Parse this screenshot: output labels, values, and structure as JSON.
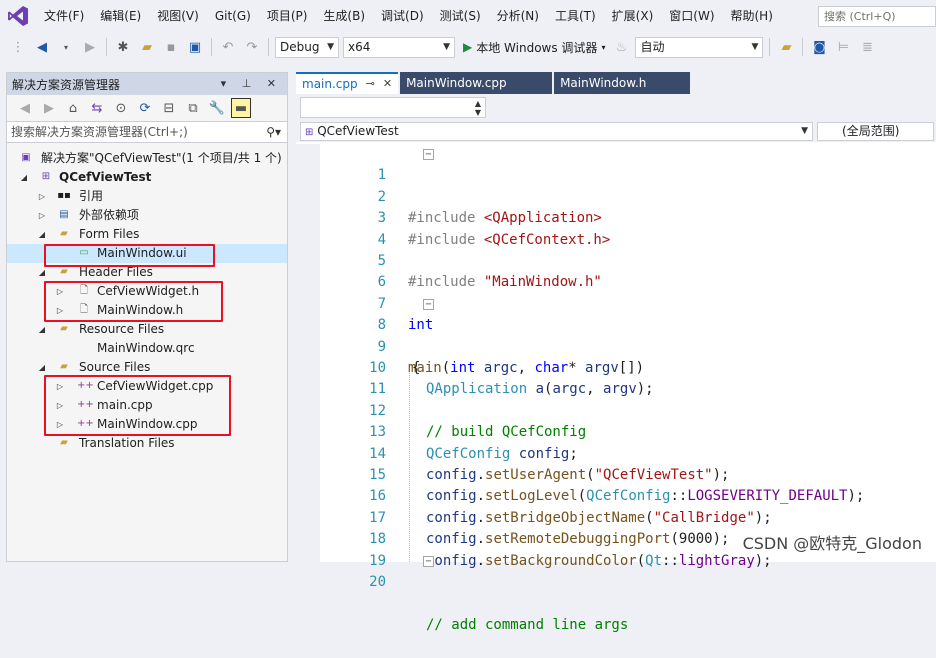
{
  "menu": {
    "items": [
      "文件(F)",
      "编辑(E)",
      "视图(V)",
      "Git(G)",
      "项目(P)",
      "生成(B)",
      "调试(D)",
      "测试(S)",
      "分析(N)",
      "工具(T)",
      "扩展(X)",
      "窗口(W)",
      "帮助(H)"
    ],
    "search_placeholder": "搜索 (Ctrl+Q)"
  },
  "toolbar": {
    "config": "Debug",
    "platform": "x64",
    "run_label": "本地 Windows 调试器",
    "mode": "自动"
  },
  "solution_explorer": {
    "title": "解决方案资源管理器",
    "search_placeholder": "搜索解决方案资源管理器(Ctrl+;)",
    "items": [
      {
        "label": "解决方案\"QCefViewTest\"(1 个项目/共 1 个)"
      },
      {
        "label": "QCefViewTest"
      },
      {
        "label": "引用"
      },
      {
        "label": "外部依赖项"
      },
      {
        "label": "Form Files"
      },
      {
        "label": "MainWindow.ui"
      },
      {
        "label": "Header Files"
      },
      {
        "label": "CefViewWidget.h"
      },
      {
        "label": "MainWindow.h"
      },
      {
        "label": "Resource Files"
      },
      {
        "label": "MainWindow.qrc"
      },
      {
        "label": "Source Files"
      },
      {
        "label": "CefViewWidget.cpp"
      },
      {
        "label": "main.cpp"
      },
      {
        "label": "MainWindow.cpp"
      },
      {
        "label": "Translation Files"
      }
    ]
  },
  "editor": {
    "tabs": [
      {
        "label": "main.cpp"
      },
      {
        "label": "MainWindow.cpp"
      },
      {
        "label": "MainWindow.h"
      }
    ],
    "project_dropdown": "QCefViewTest",
    "scope_dropdown": "(全局范围)",
    "line_numbers": [
      "1",
      "2",
      "3",
      "4",
      "5",
      "6",
      "7",
      "8",
      "9",
      "10",
      "11",
      "12",
      "13",
      "14",
      "15",
      "16",
      "17",
      "18",
      "19",
      "20"
    ],
    "code": {
      "l1_inc": "#include ",
      "l1_hdr": "<QApplication>",
      "l3_inc": "#include ",
      "l3_hdr": "<QCefContext.h>",
      "l5_inc": "#include ",
      "l5_hdr": "\"MainWindow.h\"",
      "l7": "int",
      "l8_main": "main",
      "l8_a": "(",
      "l8_int": "int",
      "l8_argc": " argc",
      "l8_c": ", ",
      "l8_char": "char",
      "l8_star": "* ",
      "l8_argv": "argv",
      "l8_end": "[])",
      "l9": "{",
      "l10_cls": "QApplication",
      "l10_a": " a",
      "l10_p": "(",
      "l10_argc": "argc",
      "l10_c": ", ",
      "l10_argv": "argv",
      "l10_end": ");",
      "l12": "// build QCefConfig",
      "l13_cls": "QCefConfig",
      "l13_var": " config",
      "l13_end": ";",
      "l14_obj": "config",
      "l14_dot": ".",
      "l14_fn": "setUserAgent",
      "l14_p": "(",
      "l14_str": "\"QCefViewTest\"",
      "l14_end": ");",
      "l15_obj": "config",
      "l15_dot": ".",
      "l15_fn": "setLogLevel",
      "l15_p": "(",
      "l15_cls": "QCefConfig",
      "l15_sc": "::",
      "l15_mac": "LOGSEVERITY_DEFAULT",
      "l15_end": ");",
      "l16_obj": "config",
      "l16_dot": ".",
      "l16_fn": "setBridgeObjectName",
      "l16_p": "(",
      "l16_str": "\"CallBridge\"",
      "l16_end": ");",
      "l17_obj": "config",
      "l17_dot": ".",
      "l17_fn": "setRemoteDebuggingPort",
      "l17_p": "(",
      "l17_num": "9000",
      "l17_end": ");",
      "l18_obj": "config",
      "l18_dot": ".",
      "l18_fn": "setBackgroundColor",
      "l18_p": "(",
      "l18_cls": "Qt",
      "l18_sc": "::",
      "l18_mac": "lightGray",
      "l18_end": ");",
      "l20": "// add command line args"
    }
  },
  "watermark": "CSDN @欧特克_Glodon"
}
